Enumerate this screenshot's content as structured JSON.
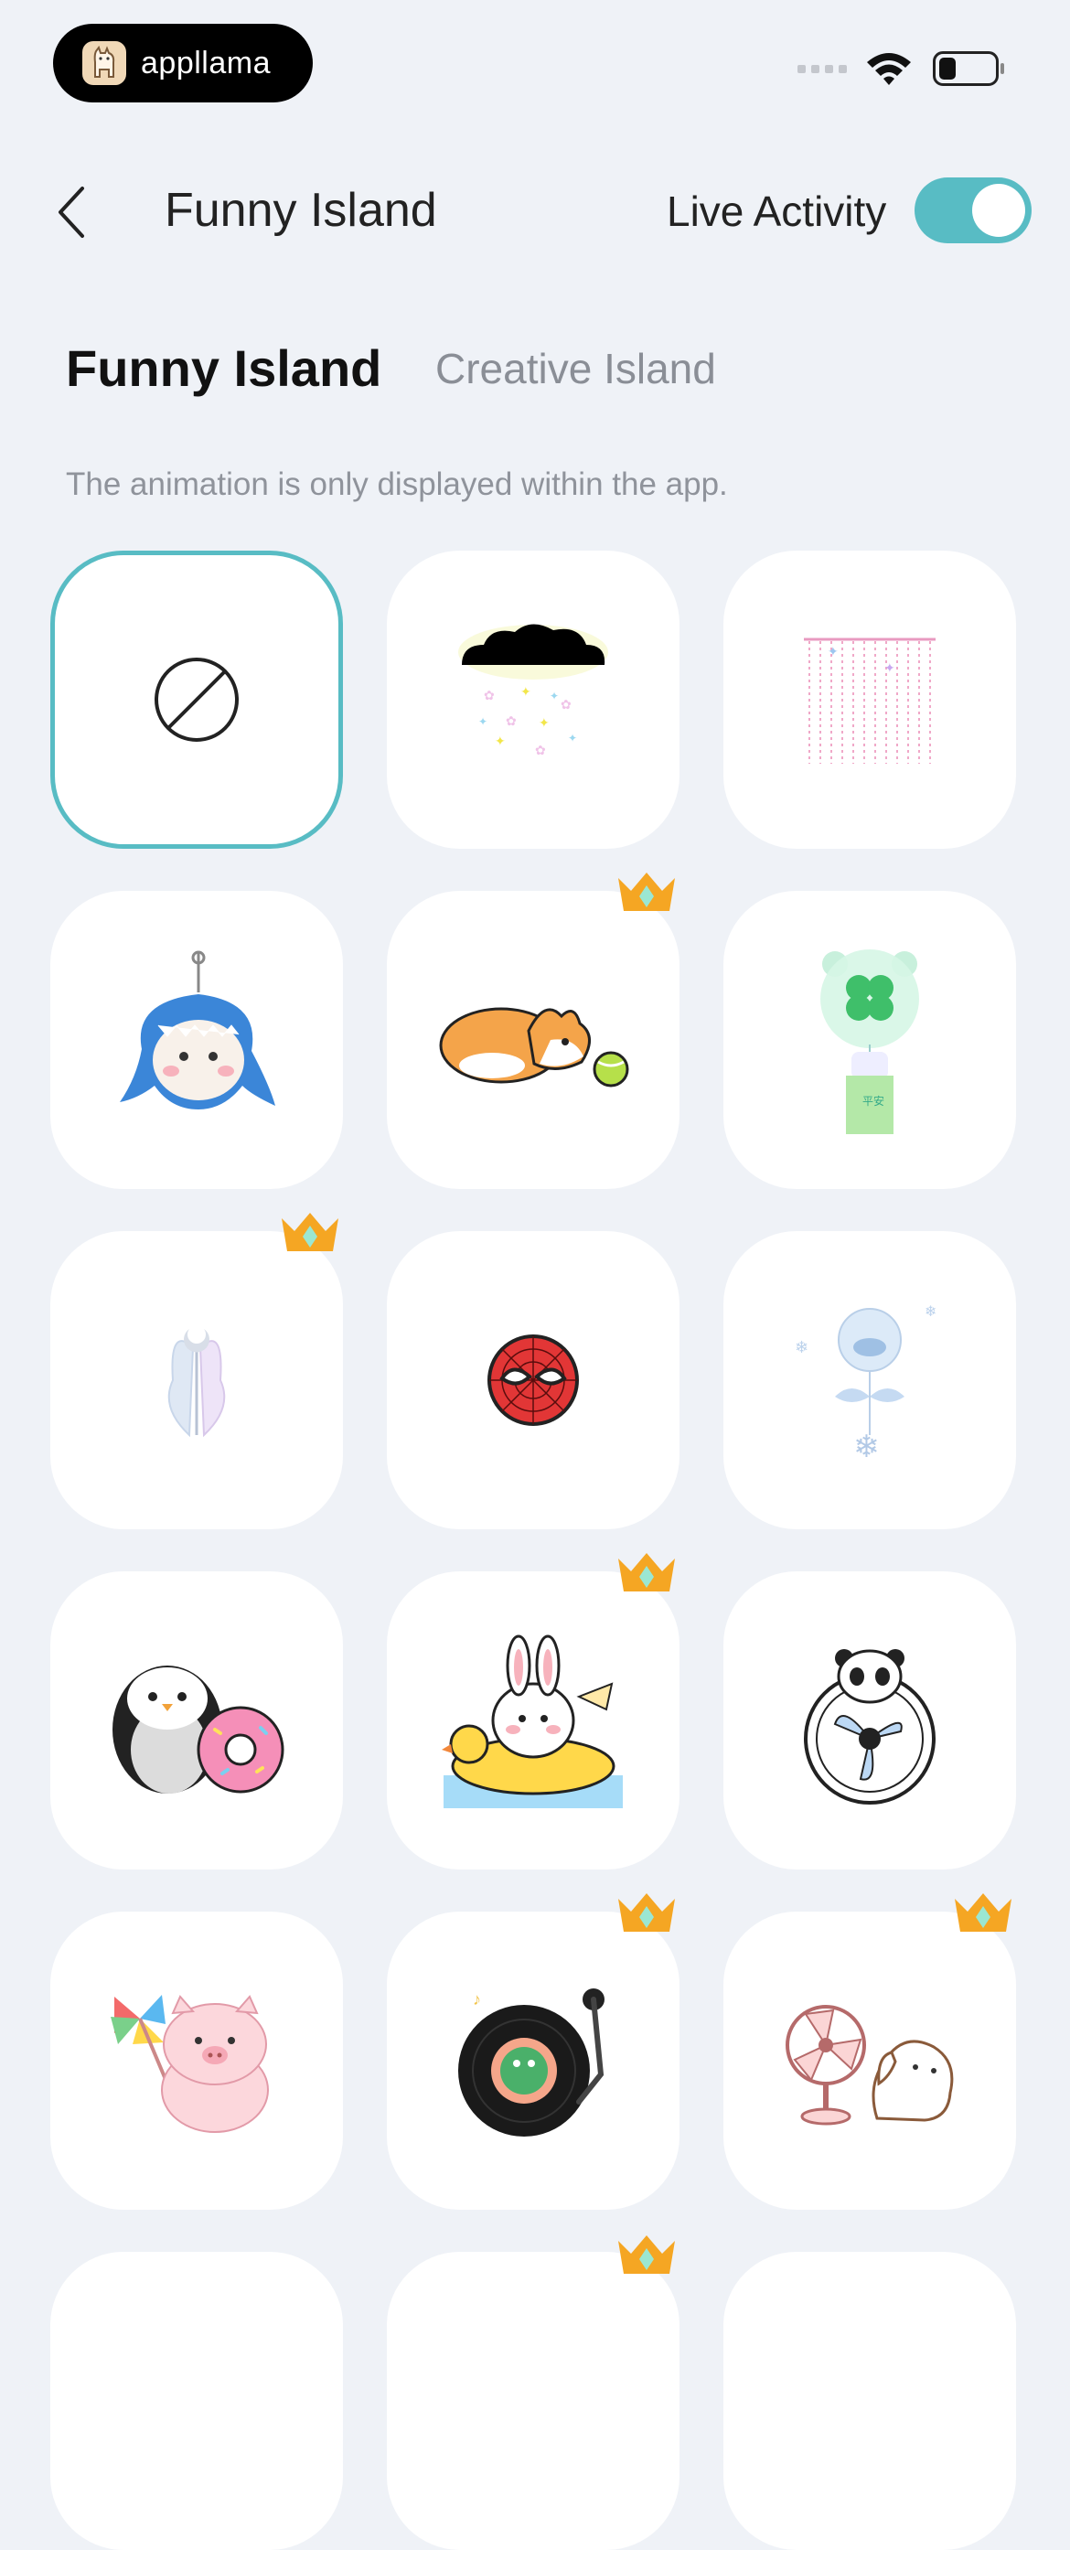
{
  "status_bar": {
    "brand_name": "appllama",
    "brand_logo_icon": "llama-icon",
    "icons": [
      "signal-icon",
      "wifi-icon",
      "battery-icon"
    ]
  },
  "header": {
    "title": "Funny Island",
    "live_activity_label": "Live Activity",
    "live_activity_enabled": true
  },
  "tabs": [
    {
      "label": "Funny Island",
      "active": true
    },
    {
      "label": "Creative Island",
      "active": false
    }
  ],
  "note": "The animation is only displayed within the app.",
  "colors": {
    "accent": "#58bcc4",
    "background": "#eff2f7",
    "crown": "#f5a623"
  },
  "animations": [
    {
      "icon": "none-icon",
      "premium": false,
      "selected": true
    },
    {
      "icon": "rain-cloud-icon",
      "premium": false,
      "selected": false
    },
    {
      "icon": "bead-curtain-icon",
      "premium": false,
      "selected": false
    },
    {
      "icon": "shark-plush-icon",
      "premium": false,
      "selected": false
    },
    {
      "icon": "corgi-ball-icon",
      "premium": true,
      "selected": false
    },
    {
      "icon": "clover-wind-chime-icon",
      "premium": false,
      "selected": false
    },
    {
      "icon": "butterfly-icon",
      "premium": true,
      "selected": false
    },
    {
      "icon": "spiderman-mask-icon",
      "premium": false,
      "selected": false
    },
    {
      "icon": "snow-chime-icon",
      "premium": false,
      "selected": false
    },
    {
      "icon": "penguin-donut-icon",
      "premium": false,
      "selected": false
    },
    {
      "icon": "bunny-duck-float-icon",
      "premium": true,
      "selected": false
    },
    {
      "icon": "panda-fan-icon",
      "premium": false,
      "selected": false
    },
    {
      "icon": "pig-pinwheel-icon",
      "premium": false,
      "selected": false
    },
    {
      "icon": "frog-record-icon",
      "premium": true,
      "selected": false
    },
    {
      "icon": "puppy-fan-icon",
      "premium": true,
      "selected": false
    },
    {
      "icon": "partial-tile-icon",
      "premium": false,
      "selected": false
    },
    {
      "icon": "partial-tile-icon",
      "premium": true,
      "selected": false
    },
    {
      "icon": "partial-tile-icon",
      "premium": false,
      "selected": false
    }
  ]
}
